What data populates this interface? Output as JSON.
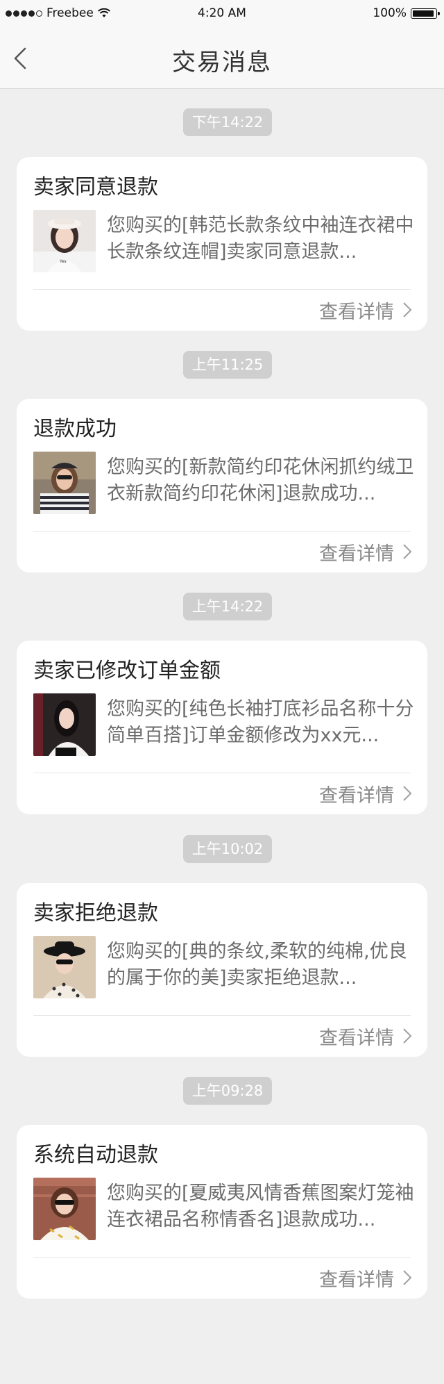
{
  "status_bar": {
    "carrier": "Freebee",
    "time": "4:20 AM",
    "battery": "100%",
    "battery_level": 1.0
  },
  "nav": {
    "title": "交易消息"
  },
  "messages": [
    {
      "time": "下午14:22",
      "title": "卖家同意退款",
      "desc": "您购买的[韩范长款条纹中袖连衣裙中长款条纹连帽]卖家同意退款...",
      "detail": "查看详情",
      "thumb_icon": "product-thumbnail-woman-hat"
    },
    {
      "time": "上午11:25",
      "title": "退款成功",
      "desc": "您购买的[新款简约印花休闲抓约绒卫衣新款简约印花休闲]退款成功...",
      "detail": "查看详情",
      "thumb_icon": "product-thumbnail-woman-cap"
    },
    {
      "time": "上午14:22",
      "title": "卖家已修改订单金额",
      "desc": "您购买的[纯色长袖打底衫品名称十分简单百搭]订单金额修改为xx元...",
      "detail": "查看详情",
      "thumb_icon": "product-thumbnail-woman-dark-hair"
    },
    {
      "time": "上午10:02",
      "title": "卖家拒绝退款",
      "desc": "您购买的[典的条纹,柔软的纯棉,优良的属于你的美]卖家拒绝退款...",
      "detail": "查看详情",
      "thumb_icon": "product-thumbnail-woman-black-hat"
    },
    {
      "time": "上午09:28",
      "title": "系统自动退款",
      "desc": "您购买的[夏威夷风情香蕉图案灯笼袖连衣裙品名称情香名]退款成功...",
      "detail": "查看详情",
      "thumb_icon": "product-thumbnail-woman-sunglasses"
    }
  ],
  "colors": {
    "background": "#efefef",
    "chip": "#cfcfcf",
    "card": "#ffffff"
  }
}
